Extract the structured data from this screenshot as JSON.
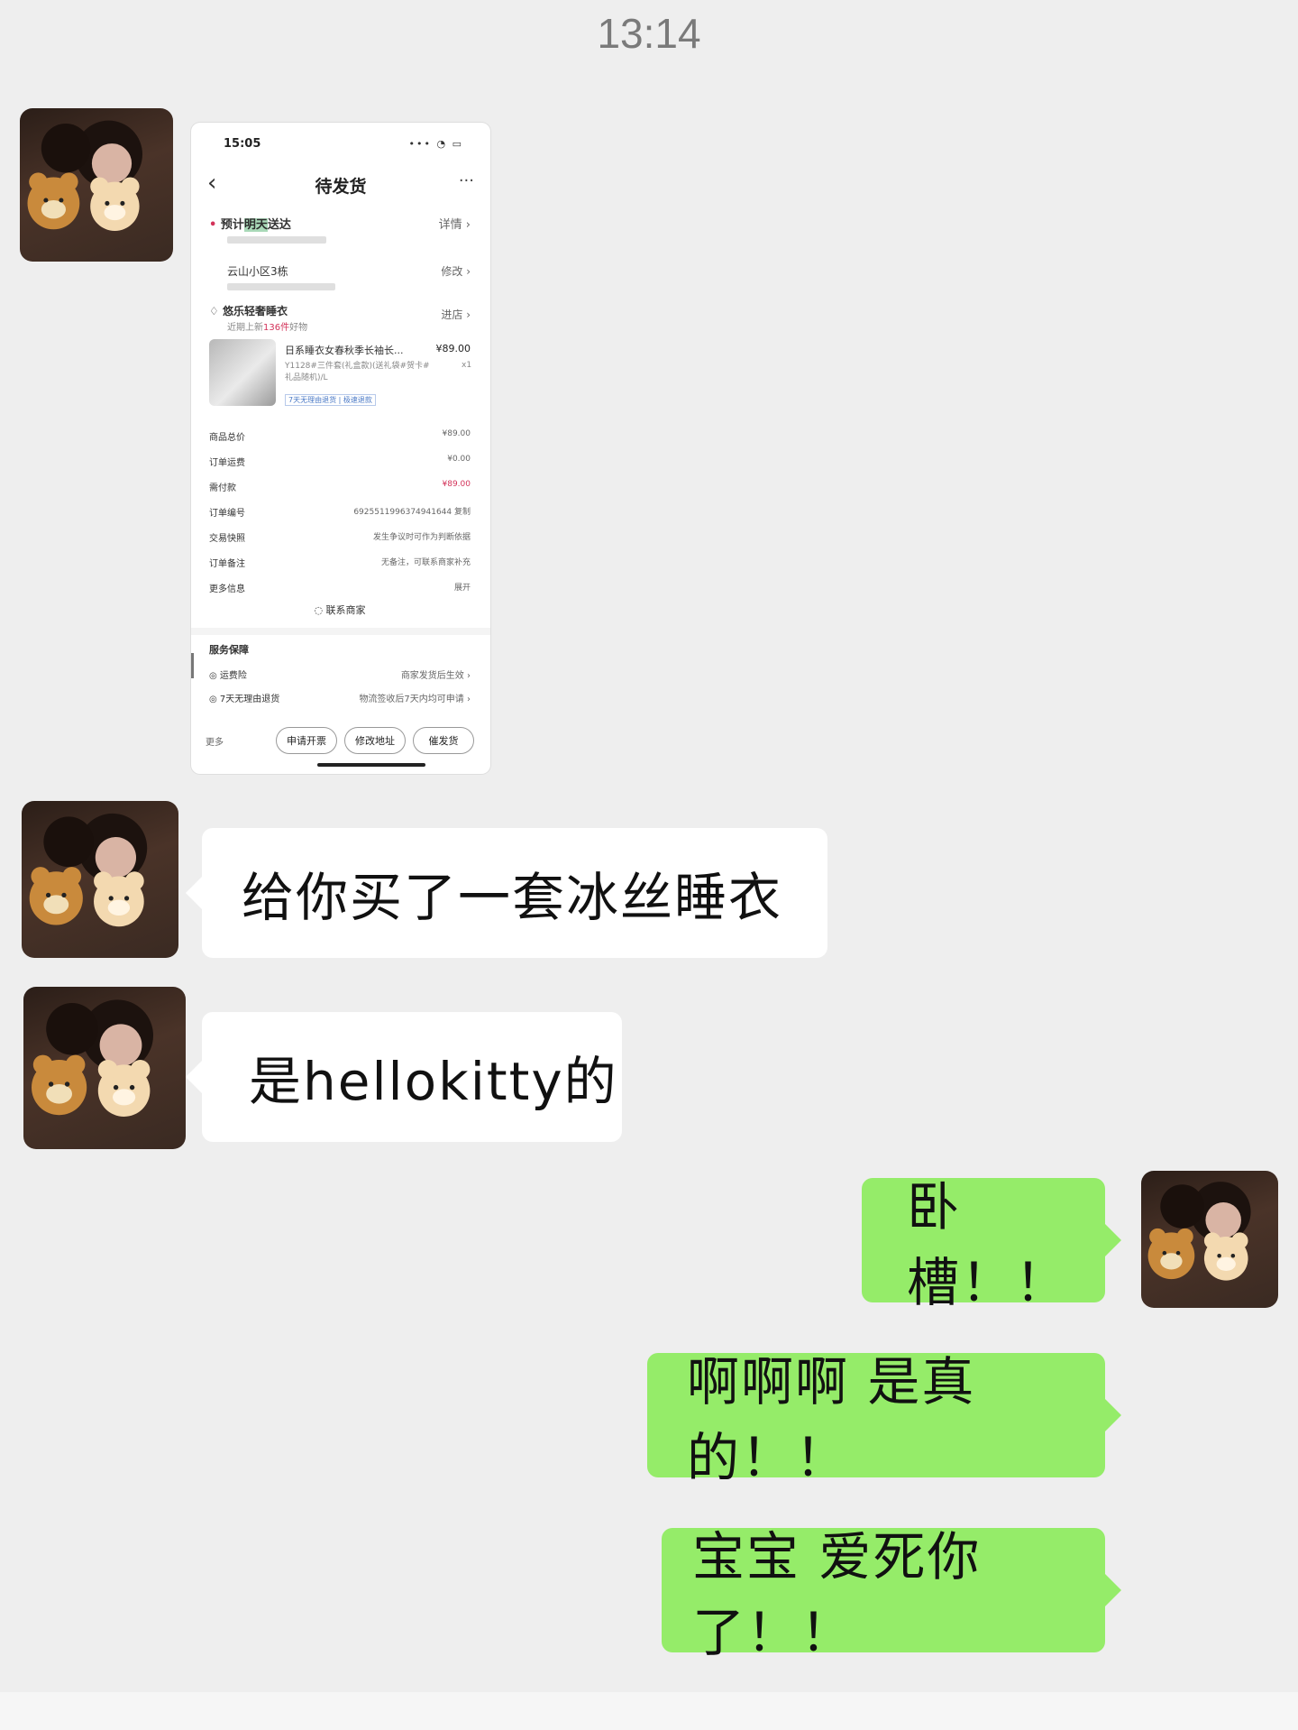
{
  "time": "13:14",
  "embedded_screenshot": {
    "status_time": "15:05",
    "status_icons": "••• ◔ ▭",
    "nav_title": "待发货",
    "back_icon": "chevron-left-icon",
    "more_icon": "ellipsis-icon",
    "delivery_prefix": "预计",
    "delivery_highlight": "明天",
    "delivery_suffix": "送达",
    "delivery_action": "详情",
    "delivery_sub": "",
    "address_name": "云山小区3栋",
    "address_action": "修改",
    "address_phone": "",
    "shop_name": "悠乐轻奢睡衣",
    "shop_sub_prefix": "近期上新",
    "shop_sub_count": "136件",
    "shop_sub_suffix": "好物",
    "shop_action": "进店",
    "product_title": "日系睡衣女春秋季长袖长...",
    "product_price": "¥89.00",
    "product_spec": "Y1128#三件套(礼盒款)(送礼袋#贺卡#礼品随机)/L",
    "product_qty": "x1",
    "product_tags": "7天无理由退货 | 极速退款",
    "summary": [
      {
        "label": "商品总价",
        "value": "¥89.00",
        "red": false
      },
      {
        "label": "订单运费",
        "value": "¥0.00",
        "red": false
      },
      {
        "label": "需付款",
        "value": "¥89.00",
        "red": true
      },
      {
        "label": "订单编号",
        "value": "6925511996374941644  复制",
        "red": false
      },
      {
        "label": "交易快照",
        "value": "发生争议时可作为判断依据",
        "red": false
      },
      {
        "label": "订单备注",
        "value": "无备注，可联系商家补充",
        "red": false
      },
      {
        "label": "更多信息",
        "value": "展开",
        "red": false
      }
    ],
    "contact_label": "联系商家",
    "service_title": "服务保障",
    "services": [
      {
        "label": "运费险",
        "value": "商家发货后生效"
      },
      {
        "label": "7天无理由退货",
        "value": "物流签收后7天内均可申请"
      }
    ],
    "bottom_more": "更多",
    "buttons": [
      "申请开票",
      "修改地址",
      "催发货"
    ]
  },
  "messages": [
    {
      "side": "left",
      "text": "给你买了一套冰丝睡衣"
    },
    {
      "side": "left",
      "text": "是hellokitty的"
    },
    {
      "side": "right",
      "text": "卧槽！！"
    },
    {
      "side": "right",
      "text": "啊啊啊 是真的！！"
    },
    {
      "side": "right",
      "text": "宝宝 爱死你了！！"
    }
  ],
  "colors": {
    "background": "#eeeeee",
    "left_bubble": "#ffffff",
    "right_bubble": "#95ec69",
    "price_red": "#d3335a"
  }
}
